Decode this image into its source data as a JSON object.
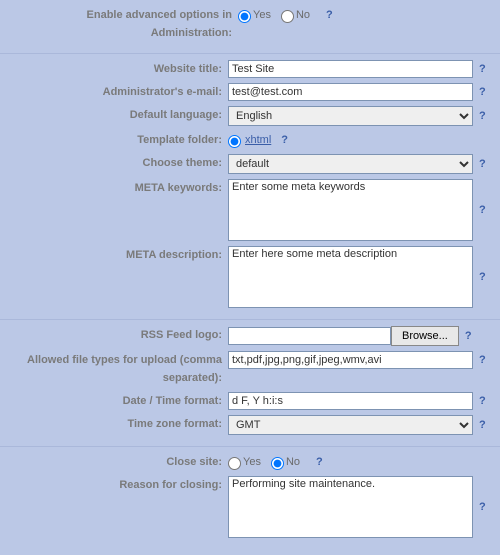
{
  "advanced": {
    "label": "Enable advanced options in Administration:",
    "yes": "Yes",
    "no": "No",
    "value": "Yes"
  },
  "website_title": {
    "label": "Website title:",
    "value": "Test Site"
  },
  "admin_email": {
    "label": "Administrator's e-mail:",
    "value": "test@test.com"
  },
  "default_language": {
    "label": "Default language:",
    "value": "English"
  },
  "template_folder": {
    "label": "Template folder:",
    "link": "xhtml"
  },
  "choose_theme": {
    "label": "Choose theme:",
    "value": "default"
  },
  "meta_keywords": {
    "label": "META keywords:",
    "value": "Enter some meta keywords"
  },
  "meta_description": {
    "label": "META description:",
    "value": "Enter here some meta description"
  },
  "rss_logo": {
    "label": "RSS Feed logo:",
    "browse": "Browse..."
  },
  "allowed_types": {
    "label": "Allowed file types for upload (comma separated):",
    "value": "txt,pdf,jpg,png,gif,jpeg,wmv,avi"
  },
  "date_time": {
    "label": "Date / Time format:",
    "value": "d F, Y h:i:s"
  },
  "timezone": {
    "label": "Time zone format:",
    "value": "GMT"
  },
  "close_site": {
    "label": "Close site:",
    "yes": "Yes",
    "no": "No",
    "value": "No"
  },
  "reason": {
    "label": "Reason for closing:",
    "value": "Performing site maintenance."
  },
  "help": "?"
}
